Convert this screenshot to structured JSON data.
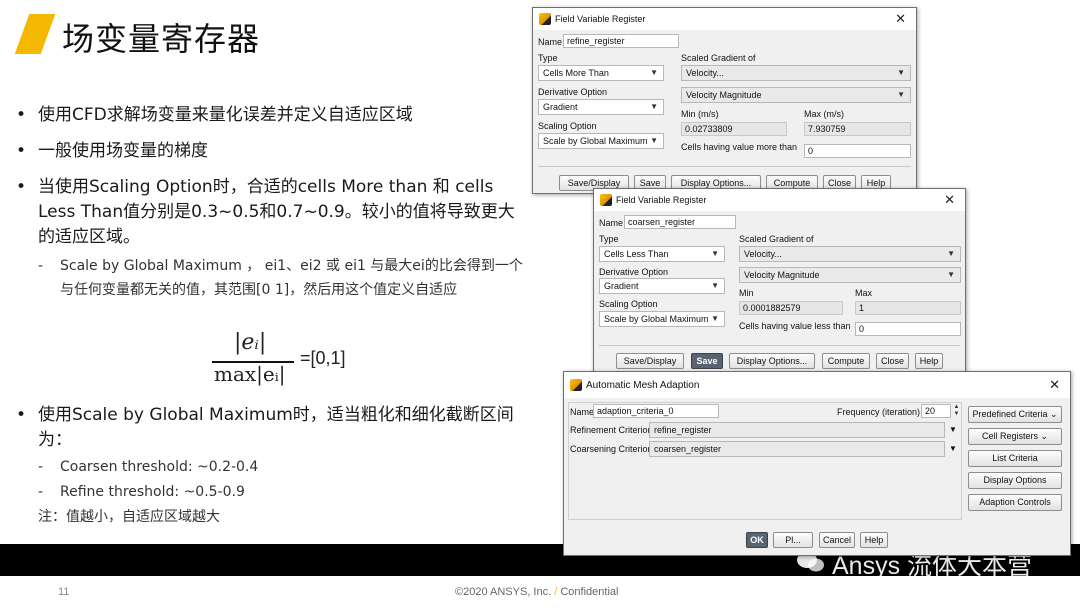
{
  "slide": {
    "title": "场变量寄存器",
    "bullets": [
      "使用CFD求解场变量来量化误差并定义自适应区域",
      "一般使用场变量的梯度",
      "当使用Scaling Option时，合适的cells More than 和 cells Less Than值分别是0.3~0.5和0.7~0.9。较小的值将导致更大的适应区域。",
      "使用Scale by Global Maximum时，适当粗化和细化截断区间为："
    ],
    "sub_scale": "Scale by Global Maximum ， ei1、ei2 或 ei1 与最大ei的比会得到一个与任何变量都无关的值，其范围[0 1]，然后用这个值定义自适应",
    "formula": {
      "numerator": "|eᵢ|",
      "denominator": "max|eᵢ|",
      "equals": "=[0,1]"
    },
    "sub_coarsen": "Coarsen threshold: ~0.2-0.4",
    "sub_refine": "Refine threshold: ~0.5-0.9",
    "note": "注：值越小，自适应区域越大",
    "bullet_symbol": "•",
    "dash_symbol": "-"
  },
  "footer": {
    "page_number": "11",
    "copyright": "©2020 ANSYS, Inc.",
    "slash": "/",
    "confidential": "Confidential",
    "watermark": "Ansys 流体大本营"
  },
  "refine_dialog": {
    "title": "Field Variable Register",
    "name_label": "Name",
    "name_value": "refine_register",
    "type_label": "Type",
    "type_value": "Cells More Than",
    "derivative_label": "Derivative Option",
    "derivative_value": "Gradient",
    "scaling_label": "Scaling Option",
    "scaling_value": "Scale by Global Maximum",
    "scaled_gradient_label": "Scaled Gradient of",
    "scaled_gradient_value": "Velocity...",
    "quantity_value": "Velocity Magnitude",
    "min_label": "Min (m/s)",
    "min_value": "0.02733809",
    "max_label": "Max (m/s)",
    "max_value": "7.930759",
    "threshold_label": "Cells having value more than",
    "threshold_value": "0",
    "buttons": [
      "Save/Display",
      "Save",
      "Display Options...",
      "Compute",
      "Close",
      "Help"
    ]
  },
  "coarsen_dialog": {
    "title": "Field Variable Register",
    "name_label": "Name",
    "name_value": "coarsen_register",
    "type_label": "Type",
    "type_value": "Cells Less Than",
    "derivative_label": "Derivative Option",
    "derivative_value": "Gradient",
    "scaling_label": "Scaling Option",
    "scaling_value": "Scale by Global Maximum",
    "scaled_gradient_label": "Scaled Gradient of",
    "scaled_gradient_value": "Velocity...",
    "quantity_value": "Velocity Magnitude",
    "min_label": "Min",
    "min_value": "0.0001882579",
    "max_label": "Max",
    "max_value": "1",
    "threshold_label": "Cells having value less than",
    "threshold_value": "0",
    "buttons": [
      "Save/Display",
      "Save",
      "Display Options...",
      "Compute",
      "Close",
      "Help"
    ]
  },
  "adaption_dialog": {
    "title": "Automatic Mesh Adaption",
    "name_label": "Name",
    "name_value": "adaption_criteria_0",
    "frequency_label": "Frequency (iteration)",
    "frequency_value": "20",
    "refinement_label": "Refinement Criterion",
    "refinement_value": "refine_register",
    "coarsening_label": "Coarsening Criterion",
    "coarsening_value": "coarsen_register",
    "side_buttons": [
      "Predefined Criteria",
      "Cell Registers",
      "List Criteria",
      "Display Options",
      "Adaption Controls"
    ],
    "bottom_buttons": [
      "OK",
      "Pl...",
      "Cancel",
      "Help"
    ]
  },
  "colors": {
    "accent": "#f5b800",
    "footer": "#000000",
    "save_active": "#5a6470"
  },
  "icons": {
    "close": "close-icon",
    "dropdown": "chevron-down-icon",
    "app": "fluent-app-icon",
    "spinner": "spinner-arrows-icon",
    "watermark": "wechat-icon"
  }
}
